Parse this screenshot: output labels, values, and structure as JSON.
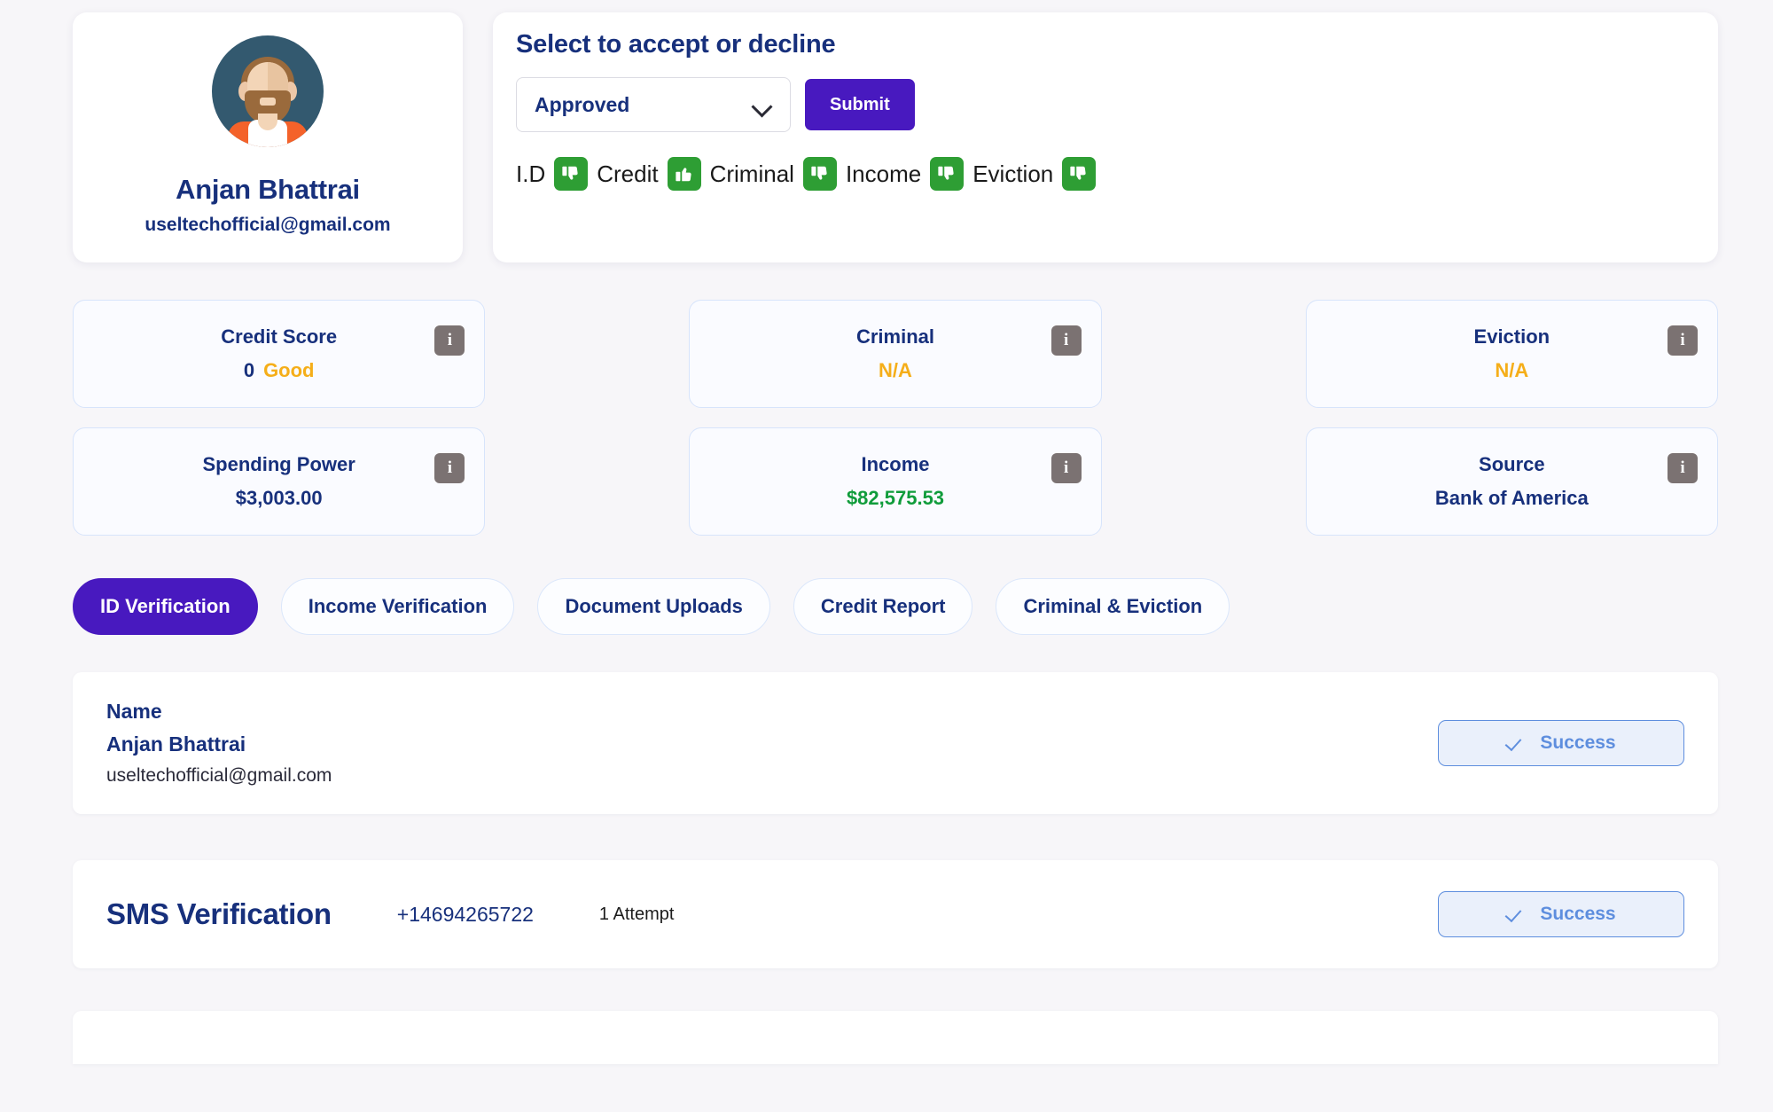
{
  "profile": {
    "avatar_icon": "user-avatar-illustration",
    "name": "Anjan Bhattrai",
    "email": "useltechofficial@gmail.com"
  },
  "decision": {
    "title": "Select to accept or decline",
    "select_value": "Approved",
    "select_icon": "chevron-down-icon",
    "submit_label": "Submit",
    "flags": [
      {
        "label": "I.D",
        "icon": "thumbs-down-icon",
        "state": "down"
      },
      {
        "label": "Credit",
        "icon": "thumbs-up-icon",
        "state": "up"
      },
      {
        "label": "Criminal",
        "icon": "thumbs-down-icon",
        "state": "down"
      },
      {
        "label": "Income",
        "icon": "thumbs-down-icon",
        "state": "down"
      },
      {
        "label": "Eviction",
        "icon": "thumbs-down-icon",
        "state": "down"
      }
    ]
  },
  "stats_row_1": [
    {
      "title": "Credit Score",
      "value": "0",
      "extra": "Good",
      "info_icon": "info-icon"
    },
    {
      "title": "Criminal",
      "value": "N/A",
      "info_icon": "info-icon"
    },
    {
      "title": "Eviction",
      "value": "N/A",
      "info_icon": "info-icon"
    }
  ],
  "stats_row_2": [
    {
      "title": "Spending Power",
      "value": "$3,003.00",
      "info_icon": "info-icon"
    },
    {
      "title": "Income",
      "value": "$82,575.53",
      "info_icon": "info-icon"
    },
    {
      "title": "Source",
      "value": "Bank of America",
      "info_icon": "info-icon"
    }
  ],
  "tabs": [
    {
      "label": "ID Verification",
      "active": true
    },
    {
      "label": "Income Verification",
      "active": false
    },
    {
      "label": "Document Uploads",
      "active": false
    },
    {
      "label": "Credit Report",
      "active": false
    },
    {
      "label": "Criminal & Eviction",
      "active": false
    }
  ],
  "name_row": {
    "label": "Name",
    "value": "Anjan Bhattrai",
    "email": "useltechofficial@gmail.com",
    "status_label": "Success",
    "status_icon": "check-icon"
  },
  "sms_row": {
    "title": "SMS Verification",
    "phone": "+14694265722",
    "attempts": "1 Attempt",
    "status_label": "Success",
    "status_icon": "check-icon"
  },
  "colors": {
    "navy": "#17307c",
    "purple": "#4819bf",
    "green_flag": "#2e9e34",
    "amber": "#f5ae19",
    "income_green": "#109c3b",
    "success_blue": "#5e8ede",
    "page_bg": "#f7f6f9"
  }
}
